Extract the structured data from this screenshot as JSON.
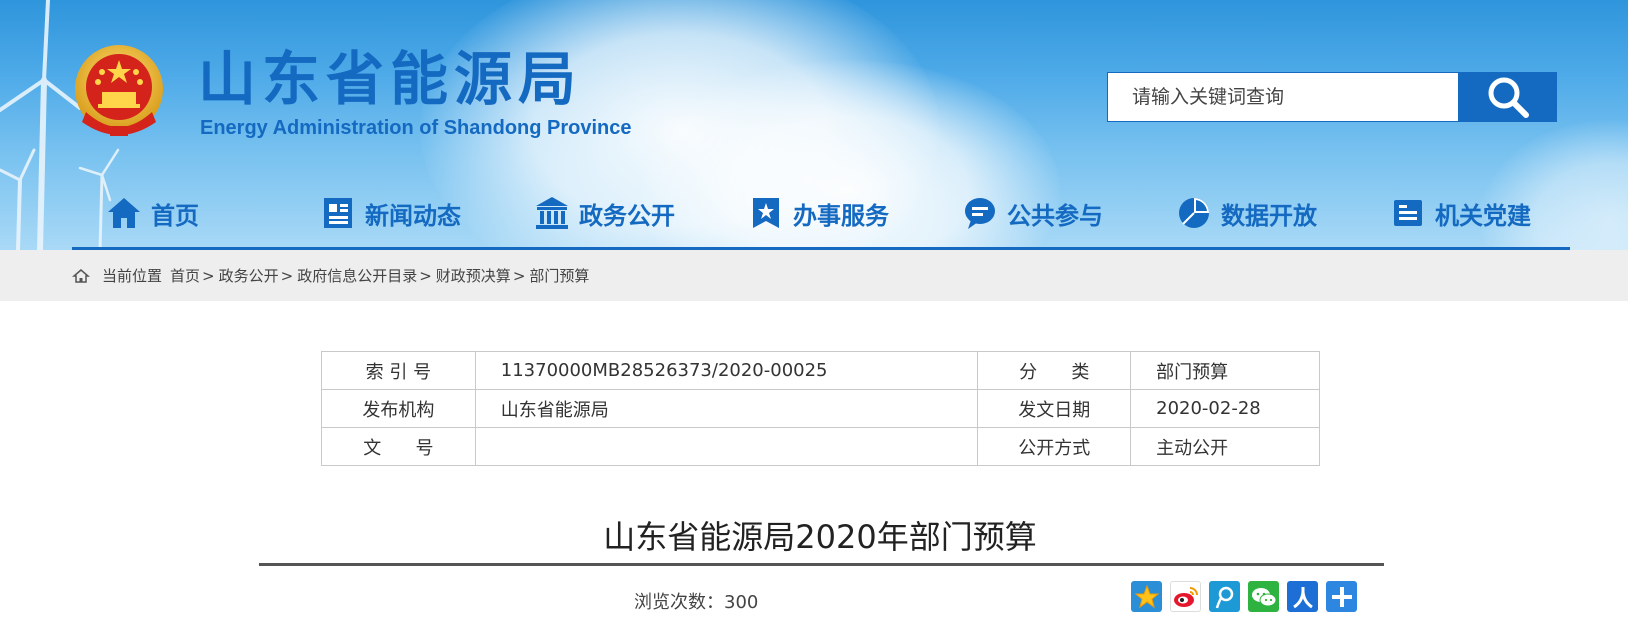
{
  "header": {
    "title": "山东省能源局",
    "subtitle": "Energy Administration of Shandong Province",
    "brand_color": "#1469c1",
    "emblem_icon": "national-emblem-icon"
  },
  "search": {
    "placeholder": "请输入关键词查询",
    "button_icon": "search-icon"
  },
  "nav": {
    "items": [
      {
        "label": "首页",
        "icon": "home-icon"
      },
      {
        "label": "新闻动态",
        "icon": "newspaper-icon"
      },
      {
        "label": "政务公开",
        "icon": "government-building-icon"
      },
      {
        "label": "办事服务",
        "icon": "star-bookmark-icon"
      },
      {
        "label": "公共参与",
        "icon": "chat-bubble-icon"
      },
      {
        "label": "数据开放",
        "icon": "pie-chart-icon"
      },
      {
        "label": "机关党建",
        "icon": "id-card-icon"
      }
    ]
  },
  "breadcrumb": {
    "prefix": "当前位置",
    "items": [
      "首页",
      "政务公开",
      "政府信息公开目录",
      "财政预决算",
      "部门预算"
    ],
    "separator": ">"
  },
  "info": {
    "rows": [
      {
        "label1": "索 引 号",
        "value1": "11370000MB28526373/2020-00025",
        "label2": "分      类",
        "value2": "部门预算"
      },
      {
        "label1": "发布机构",
        "value1": "山东省能源局",
        "label2": "发文日期",
        "value2": "2020-02-28"
      },
      {
        "label1": "文      号",
        "value1": "",
        "label2": "公开方式",
        "value2": "主动公开"
      }
    ]
  },
  "article": {
    "title": "山东省能源局2020年部门预算",
    "views_label": "浏览次数：",
    "views_count": "300"
  },
  "share": {
    "buttons": [
      "qzone-star-icon",
      "weibo-icon",
      "tencent-weibo-icon",
      "wechat-icon",
      "renren-icon",
      "more-share-plus-icon"
    ]
  }
}
